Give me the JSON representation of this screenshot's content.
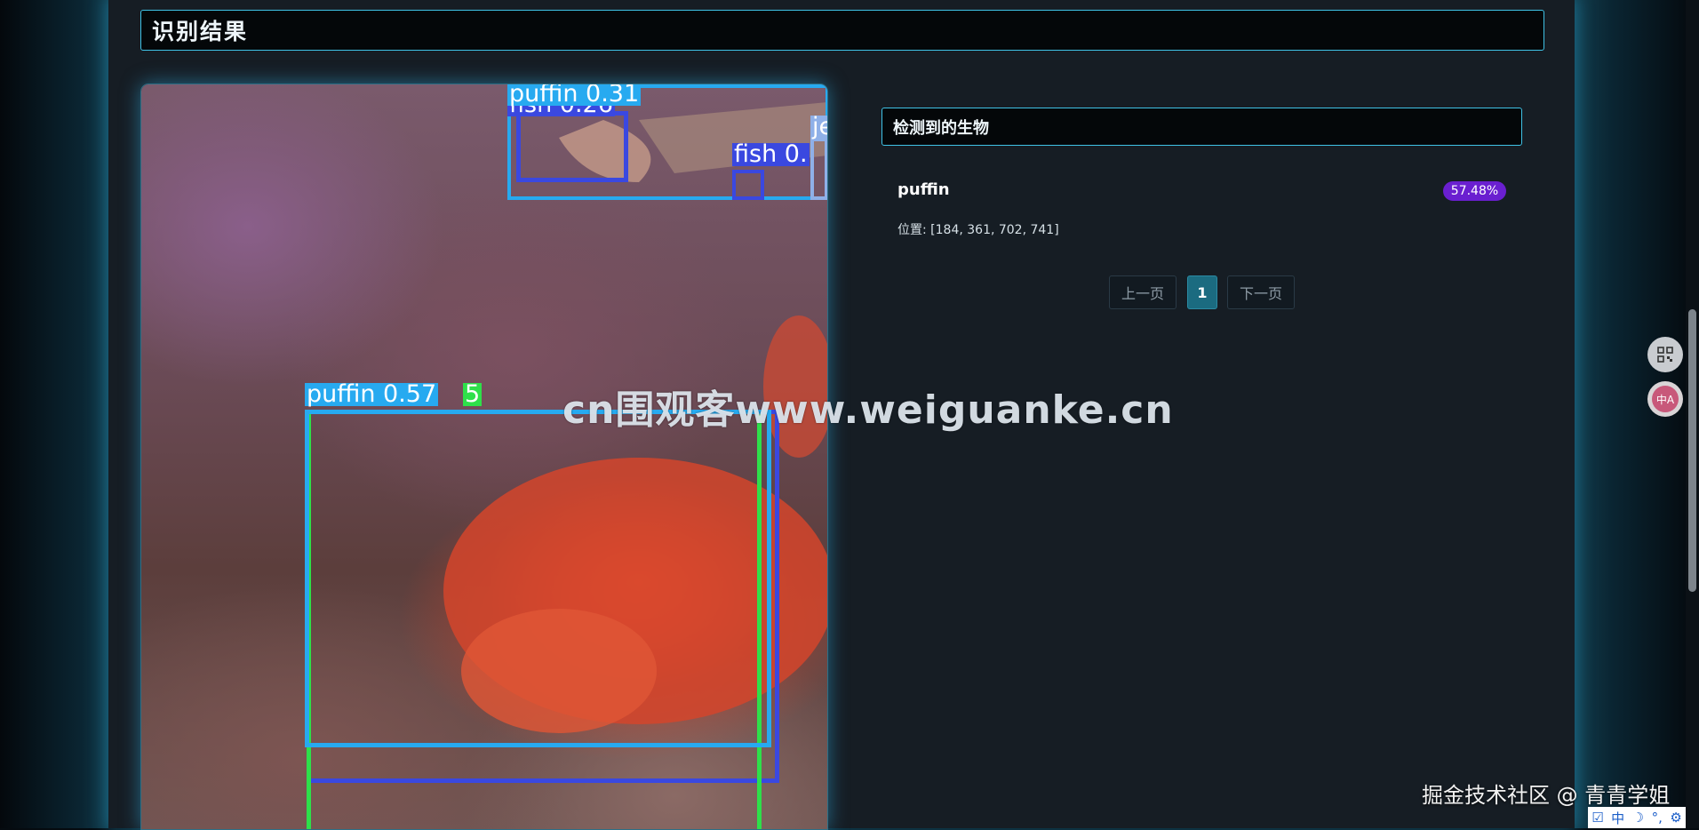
{
  "section": {
    "title": "识别结果"
  },
  "image": {
    "detections": [
      {
        "label": "puffin 0.31",
        "color": "#27aaf0"
      },
      {
        "label": "fish 0.26",
        "color": "#3a48e0"
      },
      {
        "label": "fish 0.",
        "color": "#3a48e0"
      },
      {
        "label": "je",
        "color": "#8fb0e8"
      },
      {
        "label": "puffin 0.57",
        "color": "#27aaf0"
      },
      {
        "label": "5",
        "color": "#2ee04a"
      }
    ]
  },
  "results": {
    "header": "检测到的生物",
    "items": [
      {
        "name": "puffin",
        "confidence": "57.48%",
        "position": "位置: [184, 361, 702, 741]"
      }
    ],
    "pagination": {
      "prev": "上一页",
      "current": "1",
      "next": "下一页"
    }
  },
  "overlay": {
    "watermark": "cn围观客www.weiguanke.cn",
    "credit": "掘金技术社区 @ 青青学姐"
  },
  "floating_tools": {
    "translate_label": "中A"
  },
  "ime": {
    "chinese_label": "中"
  },
  "colors": {
    "accent_cyan": "#3fc2e6",
    "badge_purple": "#6a1fd0",
    "page_active": "#1b6b80"
  }
}
